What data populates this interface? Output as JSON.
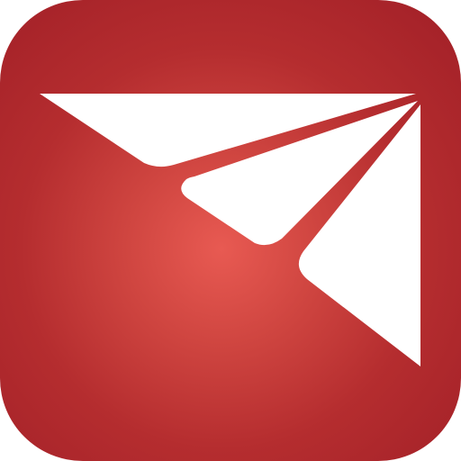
{
  "icon": {
    "name": "paper-plane-mail-icon",
    "background_color_center": "#e85a52",
    "background_color_edge": "#a11f27",
    "glyph_color": "#ffffff"
  }
}
